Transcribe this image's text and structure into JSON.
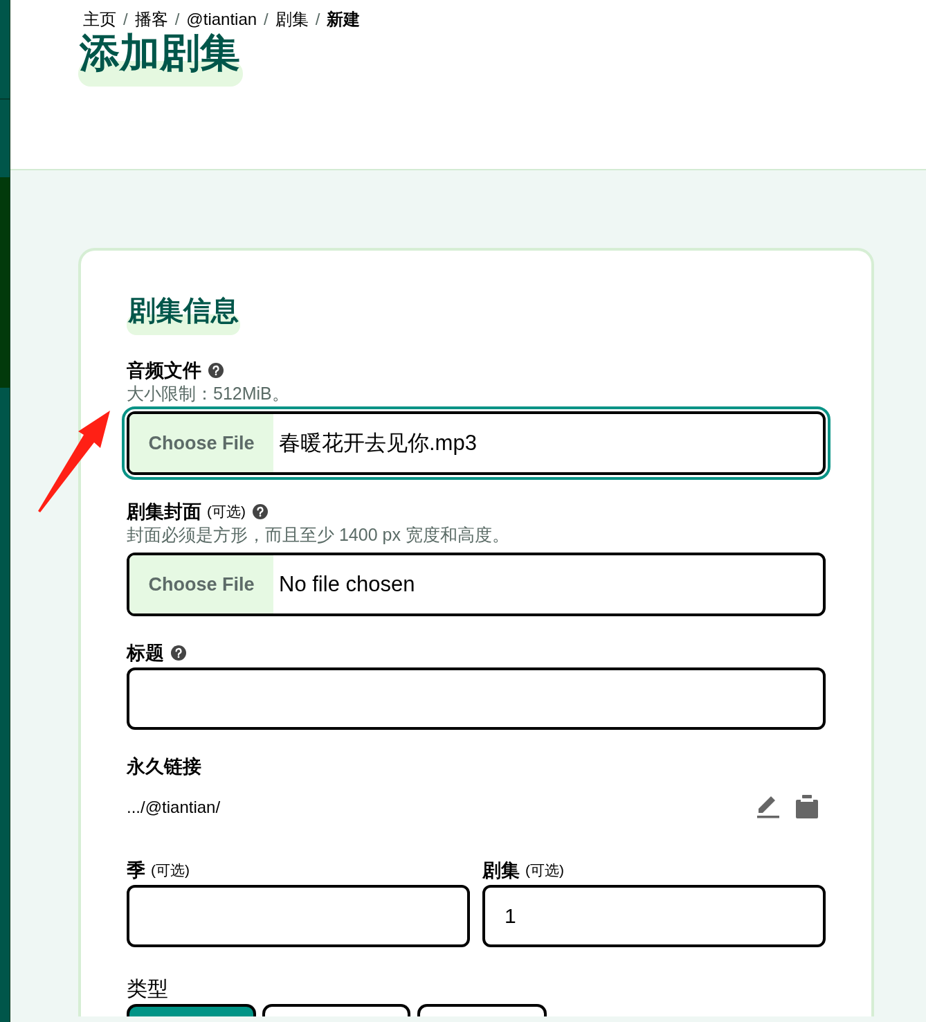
{
  "breadcrumb": [
    {
      "label": "主页",
      "current": false
    },
    {
      "separator": "/",
      "label": "播客",
      "current": false
    },
    {
      "separator": "/",
      "label": "@tiantian",
      "current": false
    },
    {
      "separator": "/",
      "label": "剧集",
      "current": false
    },
    {
      "separator": "/",
      "label": "新建",
      "current": true
    }
  ],
  "page_title": "添加剧集",
  "section": {
    "title": "剧集信息",
    "fields": [
      {
        "kind": "file",
        "label": "音频文件",
        "help": true,
        "hint": "大小限制：512MiB。",
        "button": "Choose File",
        "value": "春暖花开去见你.mp3",
        "focused": true
      },
      {
        "kind": "file",
        "label": "剧集封面",
        "optional_note": "(可选)",
        "help": true,
        "hint": "封面必须是方形，而且至少 1400 px 宽度和高度。",
        "button": "Choose File",
        "value": "No file chosen",
        "focused": false
      },
      {
        "kind": "text",
        "label": "标题",
        "help": true,
        "focused": false
      },
      {
        "kind": "permalink",
        "label": "永久链接",
        "help": false,
        "value": ".../@tiantian/"
      },
      {
        "kind": "pair",
        "fields": [
          {
            "label": "季",
            "optional_note": "(可选)",
            "help": false,
            "focused": false
          },
          {
            "label": "剧集",
            "optional_note": "(可选)",
            "help": false,
            "value": "1",
            "focused": false
          }
        ]
      },
      {
        "kind": "choice",
        "label": "类型",
        "options": [
          {
            "selected": true
          },
          {
            "selected": false
          },
          {
            "selected": false
          }
        ]
      }
    ]
  }
}
